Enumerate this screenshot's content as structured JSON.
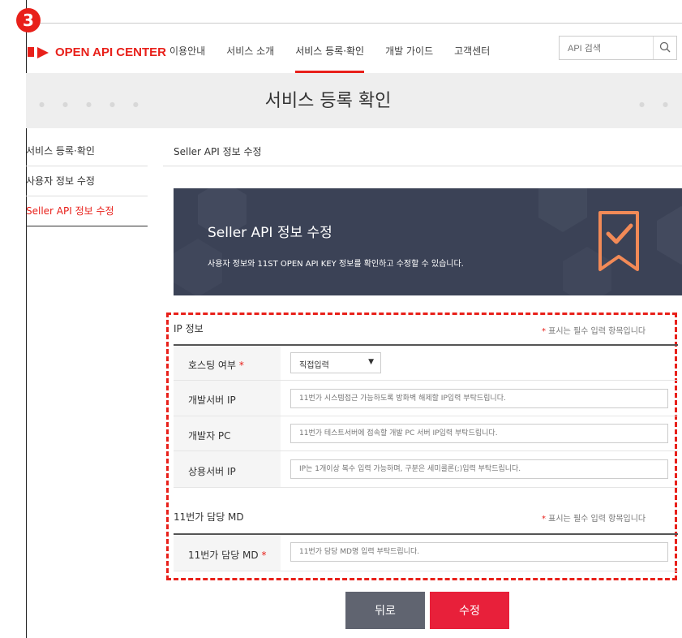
{
  "step_badge": "3",
  "logo_text": "OPEN API CENTER",
  "nav": [
    "이용안내",
    "서비스 소개",
    "서비스 등록·확인",
    "개발 가이드",
    "고객센터"
  ],
  "search": {
    "placeholder": "API 검색"
  },
  "banner_title": "서비스 등록 확인",
  "sidebar": [
    "서비스 등록·확인",
    "사용자 정보 수정",
    "Seller API 정보 수정"
  ],
  "breadcrumb": "Seller API 정보 수정",
  "hero": {
    "title": "Seller API 정보 수정",
    "desc": "사용자 정보와 11ST OPEN API KEY 정보를 확인하고 수정할 수 있습니다."
  },
  "required_note": {
    "star": "*",
    "text": " 표시는 필수 입력 항목입니다"
  },
  "ip_section": {
    "title": "IP 정보",
    "hosting": {
      "label": "호스팅 여부",
      "value": "직접입력"
    },
    "dev_server": {
      "label": "개발서버 IP",
      "placeholder": "11번가 시스템접근 가능하도록 방화벽 해제할 IP입력 부탁드립니다."
    },
    "dev_pc": {
      "label": "개발자 PC",
      "placeholder": "11번가 테스트서버에 접속할 개발 PC 서버 IP입력 부탁드립니다."
    },
    "prod_server": {
      "label": "상용서버 IP",
      "placeholder": "IP는 1개이상 복수 입력 가능하며, 구분은 세미콜론(;)입력 부탁드립니다."
    }
  },
  "md_section": {
    "title": "11번가 담당 MD",
    "md": {
      "label": "11번가 담당 MD",
      "placeholder": "11번가 담당 MD명 입력 부탁드립니다."
    }
  },
  "buttons": {
    "back": "뒤로",
    "edit": "수정"
  },
  "colors": {
    "accent": "#e8201a",
    "hero_bg": "#3b4256",
    "back_btn": "#606470"
  }
}
